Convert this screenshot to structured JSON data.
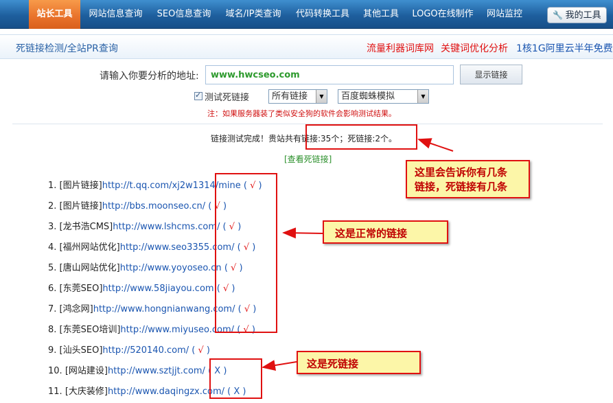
{
  "nav": {
    "items": [
      "站长工具",
      "网站信息查询",
      "SEO信息查询",
      "域名/IP类查询",
      "代码转换工具",
      "其他工具",
      "LOGO在线制作",
      "网站监控"
    ],
    "my_tools": "我的工具"
  },
  "subheader": {
    "title": "死链接检测/全站PR查询",
    "promos": [
      "流量利器词库网",
      "关键词优化分析",
      "1核1G阿里云半年免费"
    ]
  },
  "form": {
    "label": "请输入你要分析的地址:",
    "url_value": "www.hwcseo.com",
    "submit_label": "显示链接",
    "checkbox_label": "测试死链接",
    "checkbox_checked": true,
    "select_links": "所有链接",
    "select_spider": "百度蜘蛛模拟",
    "notice": "注：如果服务器装了类似安全狗的软件会影响测试结果。"
  },
  "result": {
    "summary": "链接测试完成！贵站共有链接:35个；死链接:2个。",
    "view_dead": "[查看死链接]"
  },
  "links": [
    {
      "num": "1.",
      "tag": "[图片链接]",
      "url": "http://t.qq.com/xj2w1314/mine",
      "mark": "√",
      "ok": true
    },
    {
      "num": "2.",
      "tag": "[图片链接]",
      "url": "http://bbs.moonseo.cn/",
      "mark": "√",
      "ok": true
    },
    {
      "num": "3.",
      "tag": "[龙书浩CMS]",
      "url": "http://www.lshcms.com/",
      "mark": "√",
      "ok": true
    },
    {
      "num": "4.",
      "tag": "[福州网站优化]",
      "url": "http://www.seo3355.com/",
      "mark": "√",
      "ok": true
    },
    {
      "num": "5.",
      "tag": "[唐山网站优化]",
      "url": "http://www.yoyoseo.cn",
      "mark": "√",
      "ok": true
    },
    {
      "num": "6.",
      "tag": "[东莞SEO]",
      "url": "http://www.58jiayou.com",
      "mark": "√",
      "ok": true
    },
    {
      "num": "7.",
      "tag": "[鸿念网]",
      "url": "http://www.hongnianwang.com/",
      "mark": "√",
      "ok": true
    },
    {
      "num": "8.",
      "tag": "[东莞SEO培训]",
      "url": "http://www.miyuseo.com/",
      "mark": "√",
      "ok": true
    },
    {
      "num": "9.",
      "tag": "[汕头SEO]",
      "url": "http://520140.com/",
      "mark": "√",
      "ok": true
    },
    {
      "num": "10.",
      "tag": "[网站建设]",
      "url": "http://www.sztjjt.com/",
      "mark": "X",
      "ok": false
    },
    {
      "num": "11.",
      "tag": "[大庆装修]",
      "url": "http://www.daqingzx.com/",
      "mark": "X",
      "ok": false
    }
  ],
  "annotations": {
    "count_note_line1": "这里会告诉你有几条",
    "count_note_line2": "链接，死链接有几条",
    "normal_note": "这是正常的链接",
    "dead_note": "这是死链接"
  },
  "colors": {
    "nav_bg": "#1e5f9e",
    "nav_active": "#e8712a",
    "link_blue": "#1a55b0",
    "ok_red": "#e01010",
    "callout_bg": "#fcf6a8",
    "annotation_red": "#e01010"
  }
}
